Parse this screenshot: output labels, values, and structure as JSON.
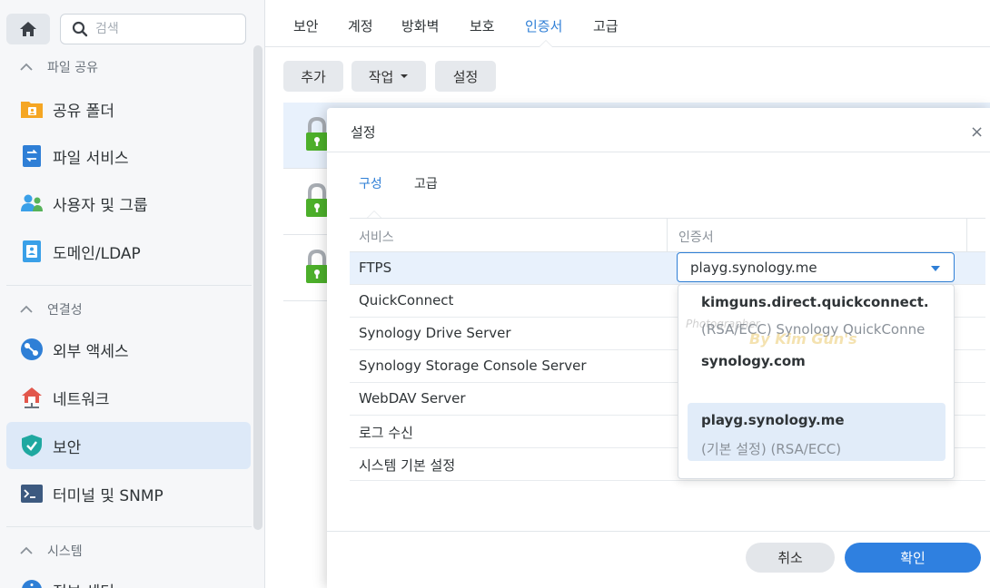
{
  "sidebar": {
    "search_placeholder": "검색",
    "groups": {
      "file_sharing": "파일 공유",
      "connectivity": "연결성",
      "system": "시스템"
    },
    "items": [
      {
        "label": "공유 폴더",
        "icon": "folder-icon"
      },
      {
        "label": "파일 서비스",
        "icon": "file-services-icon"
      },
      {
        "label": "사용자 및 그룹",
        "icon": "users-icon"
      },
      {
        "label": "도메인/LDAP",
        "icon": "domain-icon"
      },
      {
        "label": "외부 액세스",
        "icon": "external-access-icon"
      },
      {
        "label": "네트워크",
        "icon": "network-icon"
      },
      {
        "label": "보안",
        "icon": "shield-icon",
        "active": true
      },
      {
        "label": "터미널 및 SNMP",
        "icon": "terminal-icon"
      },
      {
        "label": "정보 센터",
        "icon": "info-icon"
      }
    ]
  },
  "main": {
    "tabs": [
      "보안",
      "계정",
      "방화벽",
      "보호",
      "인증서",
      "고급"
    ],
    "active_tab": "인증서",
    "toolbar": {
      "add": "추가",
      "action": "작업",
      "settings": "설정"
    }
  },
  "dialog": {
    "title": "설정",
    "close": "×",
    "tabs": {
      "config": "구성",
      "advanced": "고급"
    },
    "columns": {
      "service": "서비스",
      "certificate": "인증서"
    },
    "rows": [
      "FTPS",
      "QuickConnect",
      "Synology Drive Server",
      "Synology Storage Console Server",
      "WebDAV Server",
      "로그 수신",
      "시스템 기본 설정"
    ],
    "selected_certificate": "playg.synology.me",
    "dropdown": [
      {
        "name": "kimguns.direct.quickconnect.",
        "desc": "(RSA/ECC) Synology QuickConne"
      },
      {
        "name": "synology.com",
        "desc": ""
      },
      {
        "name": "playg.synology.me",
        "desc": "(기본 설정) (RSA/ECC)"
      }
    ],
    "watermark_1": "Photographer",
    "watermark_2": "By Kim Gun's",
    "cancel": "취소",
    "ok": "확인"
  },
  "colors": {
    "accent": "#2f7fd6",
    "lock_green": "#4caf2a",
    "active_bg": "#dde9f8"
  }
}
